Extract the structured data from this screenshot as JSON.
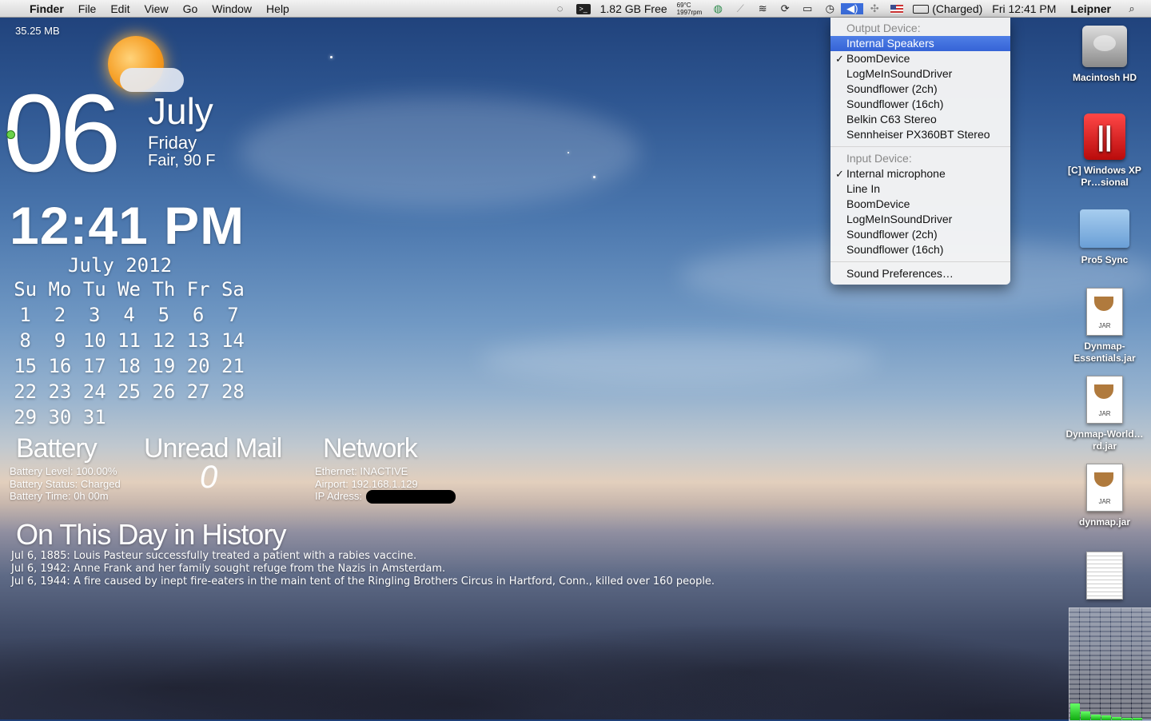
{
  "menubar": {
    "app": "Finder",
    "menus": [
      "File",
      "Edit",
      "View",
      "Go",
      "Window",
      "Help"
    ],
    "free_space": "1.82 GB Free",
    "temp": "69°C",
    "fan": "1997rpm",
    "battery": "(Charged)",
    "datetime": "Fri 12:41 PM",
    "user": "Leipner"
  },
  "sound_menu": {
    "output_header": "Output Device:",
    "outputs": [
      "Internal Speakers",
      "BoomDevice",
      "LogMeInSoundDriver",
      "Soundflower (2ch)",
      "Soundflower (16ch)",
      "Belkin C63 Stereo",
      "Sennheiser PX360BT Stereo"
    ],
    "input_header": "Input Device:",
    "inputs": [
      "Internal microphone",
      "Line In",
      "BoomDevice",
      "LogMeInSoundDriver",
      "Soundflower (2ch)",
      "Soundflower (16ch)"
    ],
    "preferences": "Sound Preferences…"
  },
  "desktop_icons": {
    "macintosh_hd": "Macintosh HD",
    "windows_xp": "[C] Windows XP Pr…sional",
    "pro5_sync": "Pro5 Sync",
    "dynmap_essentials": "Dynmap-Essentials.jar",
    "dynmap_world": "Dynmap-World…rd.jar",
    "dynmap": "dynmap.jar",
    "jar_label": "JAR"
  },
  "widgets": {
    "memory": "35.25 MB",
    "day_number": "06",
    "month": "July",
    "weekday": "Friday",
    "weather": "Fair, 90 F",
    "clock": "12:41 PM",
    "calendar": {
      "title": "July 2012",
      "weekdays": [
        "Su",
        "Mo",
        "Tu",
        "We",
        "Th",
        "Fr",
        "Sa"
      ],
      "weeks": [
        [
          "1",
          "2",
          "3",
          "4",
          "5",
          "6",
          "7"
        ],
        [
          "8",
          "9",
          "10",
          "11",
          "12",
          "13",
          "14"
        ],
        [
          "15",
          "16",
          "17",
          "18",
          "19",
          "20",
          "21"
        ],
        [
          "22",
          "23",
          "24",
          "25",
          "26",
          "27",
          "28"
        ],
        [
          "29",
          "30",
          "31",
          "",
          "",
          "",
          ""
        ]
      ]
    },
    "battery": {
      "title": "Battery",
      "level": "Battery Level: 100.00%",
      "status": "Battery Status: Charged",
      "time": "Battery Time: 0h 00m"
    },
    "mail": {
      "title": "Unread Mail",
      "count": "0"
    },
    "network": {
      "title": "Network",
      "ethernet": "Ethernet: INACTIVE",
      "airport": "Airport: 192.168.1.129",
      "ip": "IP Adress:"
    },
    "history": {
      "title": "On This Day in History",
      "items": [
        "Jul 6, 1885: Louis Pasteur successfully treated a patient with a rabies vaccine.",
        "Jul 6, 1942: Anne Frank and her family sought refuge from the Nazis in Amsterdam.",
        "Jul 6, 1944: A fire caused by inept fire-eaters in the main tent of the Ringling Brothers Circus in Hartford, Conn., killed over 160 people."
      ]
    }
  },
  "meter": {
    "levels": [
      0.15,
      0.08,
      0.05,
      0.04,
      0.03,
      0.02,
      0.02
    ]
  }
}
